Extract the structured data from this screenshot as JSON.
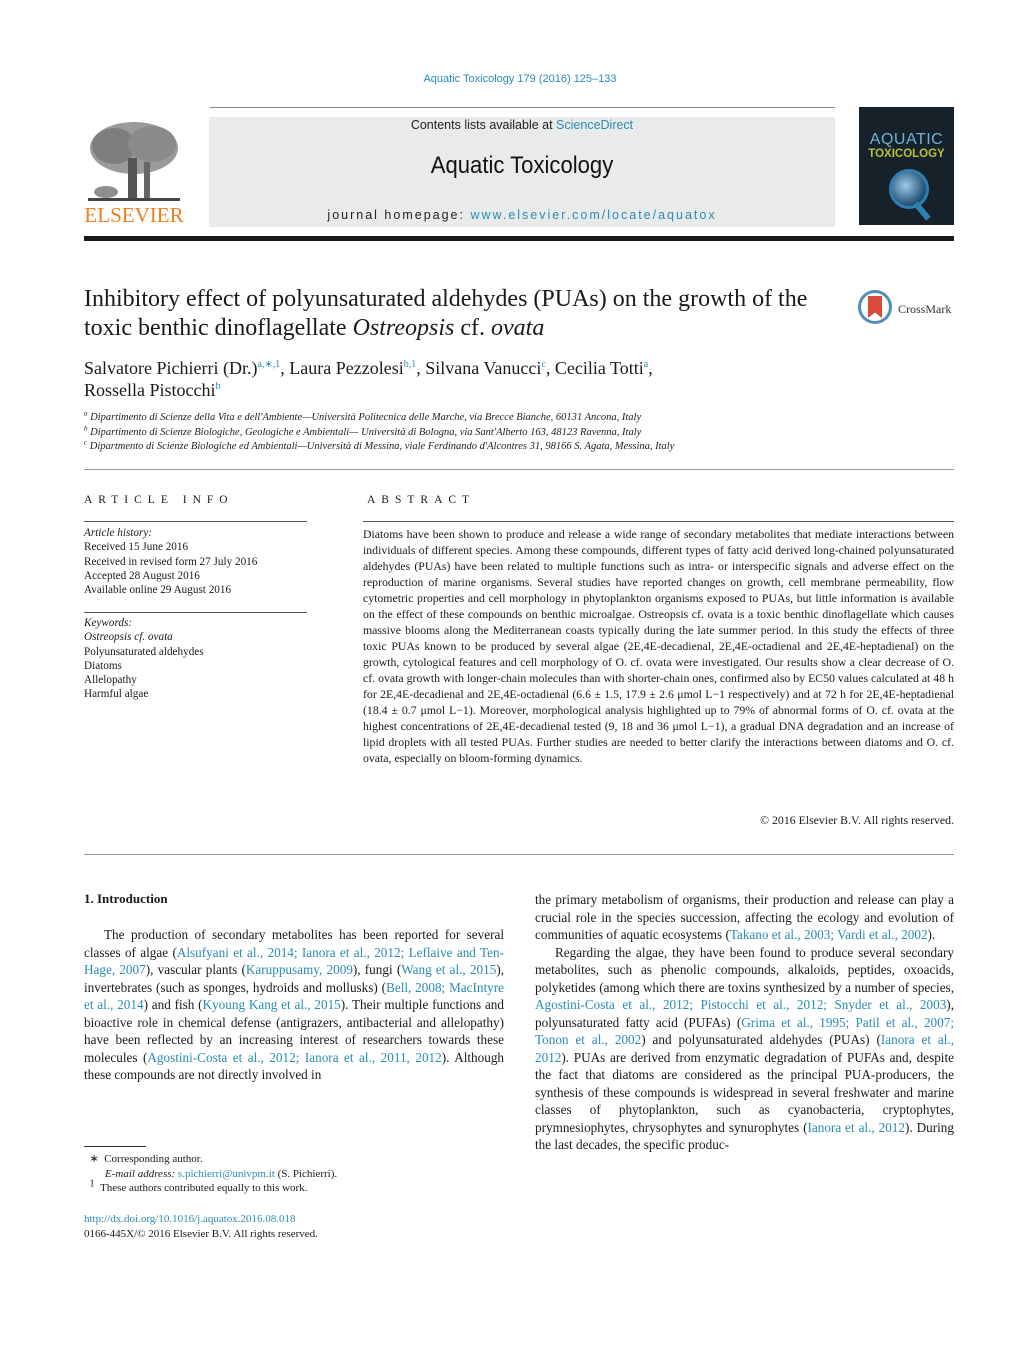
{
  "header": {
    "journal_reference": "Aquatic Toxicology 179 (2016) 125–133",
    "contents_prefix": "Contents lists available at ",
    "contents_link": "ScienceDirect",
    "journal_title": "Aquatic Toxicology",
    "homepage_prefix": "journal homepage: ",
    "homepage_link": "www.elsevier.com/locate/aquatox",
    "publisher_logo_text": "ELSEVIER",
    "cover_line1": "AQUATIC",
    "cover_line2": "TOXICOLOGY",
    "crossmark_label": "CrossMark"
  },
  "article": {
    "title_part1": "Inhibitory effect of polyunsaturated aldehydes (PUAs) on the growth of the toxic benthic dinoflagellate ",
    "title_italic1": "Ostreopsis",
    "title_part2": " cf. ",
    "title_italic2": "ovata",
    "authors": [
      {
        "name": "Salvatore Pichierri (Dr.)",
        "sup": "a,∗,1",
        "sep": ", "
      },
      {
        "name": "Laura Pezzolesi",
        "sup": "b,1",
        "sep": ", "
      },
      {
        "name": "Silvana Vanucci",
        "sup": "c",
        "sep": ", "
      },
      {
        "name": "Cecilia Totti",
        "sup": "a",
        "sep": ","
      },
      {
        "name": "Rossella Pistocchi",
        "sup": "b",
        "sep": ""
      }
    ],
    "affiliations": [
      {
        "key": "a",
        "text": "Dipartimento di Scienze della Vita e dell'Ambiente—Università Politecnica delle Marche, via Brecce Bianche, 60131 Ancona, Italy"
      },
      {
        "key": "b",
        "text": "Dipartimento di Scienze Biologiche, Geologiche e Ambientali— Università di Bologna, via Sant'Alberto 163, 48123 Ravenna, Italy"
      },
      {
        "key": "c",
        "text": "Dipartmento di Scienze Biologiche ed Ambientali—Università di Messina, viale Ferdinando d'Alcontres 31, 98166 S. Agata, Messina, Italy"
      }
    ]
  },
  "article_info": {
    "heading": "ARTICLE INFO",
    "history_label": "Article history:",
    "history": [
      "Received 15 June 2016",
      "Received in revised form 27 July 2016",
      "Accepted 28 August 2016",
      "Available online 29 August 2016"
    ],
    "keywords_label": "Keywords:",
    "keywords": [
      "Ostreopsis cf. ovata",
      "Polyunsaturated aldehydes",
      "Diatoms",
      "Allelopathy",
      "Harmful algae"
    ]
  },
  "abstract": {
    "heading": "ABSTRACT",
    "text": "Diatoms have been shown to produce and release a wide range of secondary metabolites that mediate interactions between individuals of different species. Among these compounds, different types of fatty acid derived long-chained polyunsaturated aldehydes (PUAs) have been related to multiple functions such as intra- or interspecific signals and adverse effect on the reproduction of marine organisms. Several studies have reported changes on growth, cell membrane permeability, flow cytometric properties and cell morphology in phytoplankton organisms exposed to PUAs, but little information is available on the effect of these compounds on benthic microalgae. Ostreopsis cf. ovata is a toxic benthic dinoflagellate which causes massive blooms along the Mediterranean coasts typically during the late summer period. In this study the effects of three toxic PUAs known to be produced by several algae (2E,4E-decadienal, 2E,4E-octadienal and 2E,4E-heptadienal) on the growth, cytological features and cell morphology of O. cf. ovata were investigated. Our results show a clear decrease of O. cf. ovata growth with longer-chain molecules than with shorter-chain ones, confirmed also by EC50 values calculated at 48 h for 2E,4E-decadienal and 2E,4E-octadienal (6.6 ± 1.5, 17.9 ± 2.6 μmol L−1 respectively) and at 72 h for 2E,4E-heptadienal (18.4 ± 0.7 μmol L−1). Moreover, morphological analysis highlighted up to 79% of abnormal forms of O. cf. ovata at the highest concentrations of 2E,4E-decadienal tested (9, 18 and 36 μmol L−1), a gradual DNA degradation and an increase of lipid droplets with all tested PUAs. Further studies are needed to better clarify the interactions between diatoms and O. cf. ovata, especially on bloom-forming dynamics.",
    "copyright": "© 2016 Elsevier B.V. All rights reserved."
  },
  "introduction": {
    "heading": "1.  Introduction",
    "col1": [
      {
        "t": "The production of secondary metabolites has been reported for several classes of algae ("
      },
      {
        "l": "Alsufyani et al., 2014; Ianora et al., 2012; Leflaive and Ten-Hage, 2007"
      },
      {
        "t": "), vascular plants ("
      },
      {
        "l": "Karuppusamy, 2009"
      },
      {
        "t": "), fungi ("
      },
      {
        "l": "Wang et al., 2015"
      },
      {
        "t": "), invertebrates (such as sponges, hydroids and mollusks) ("
      },
      {
        "l": "Bell, 2008; MacIntyre et al., 2014"
      },
      {
        "t": ") and fish ("
      },
      {
        "l": "Kyoung Kang et al., 2015"
      },
      {
        "t": "). Their multiple functions and bioactive role in chemical defense (antigrazers, antibacterial and allelopathy) have been reflected by an increasing interest of researchers towards these molecules ("
      },
      {
        "l": "Agostini-Costa et al., 2012; Ianora et al., 2011, 2012"
      },
      {
        "t": "). Although these compounds are not directly involved in"
      }
    ],
    "col2_p1": [
      {
        "t": "the primary metabolism of organisms, their production and release can play a crucial role in the species succession, affecting the ecology and evolution of communities of aquatic ecosystems ("
      },
      {
        "l": "Takano et al., 2003; Vardi et al., 2002"
      },
      {
        "t": ")."
      }
    ],
    "col2_p2": [
      {
        "t": "Regarding the algae, they have been found to produce several secondary metabolites, such as phenolic compounds, alkaloids, peptides, oxoacids, polyketides (among which there are toxins synthesized by a number of species, "
      },
      {
        "l": "Agostini-Costa et al., 2012; Pistocchi et al., 2012; Snyder et al., 2003"
      },
      {
        "t": "), polyunsaturated fatty acid (PUFAs) ("
      },
      {
        "l": "Grima et al., 1995; Patil et al., 2007; Tonon et al., 2002"
      },
      {
        "t": ") and polyunsaturated aldehydes (PUAs) ("
      },
      {
        "l": "Ianora et al., 2012"
      },
      {
        "t": "). PUAs are derived from enzymatic degradation of PUFAs and, despite the fact that diatoms are considered as the principal PUA-producers, the synthesis of these compounds is widespread in several freshwater and marine classes of phytoplankton, such as cyanobacteria, cryptophytes, prymnesiophytes, chrysophytes and synurophytes ("
      },
      {
        "l": "Ianora et al., 2012"
      },
      {
        "t": "). During the last decades, the specific produc-"
      }
    ]
  },
  "footnotes": {
    "corresponding_mark": "∗",
    "corresponding_text": "Corresponding author.",
    "email_label": "E-mail address: ",
    "email": "s.pichierri@univpm.it",
    "email_suffix": " (S. Pichierri).",
    "equal_mark": "1",
    "equal_text": "These authors contributed equally to this work.",
    "doi": "http://dx.doi.org/10.1016/j.aquatox.2016.08.018",
    "issn_copyright": "0166-445X/© 2016 Elsevier B.V. All rights reserved."
  }
}
